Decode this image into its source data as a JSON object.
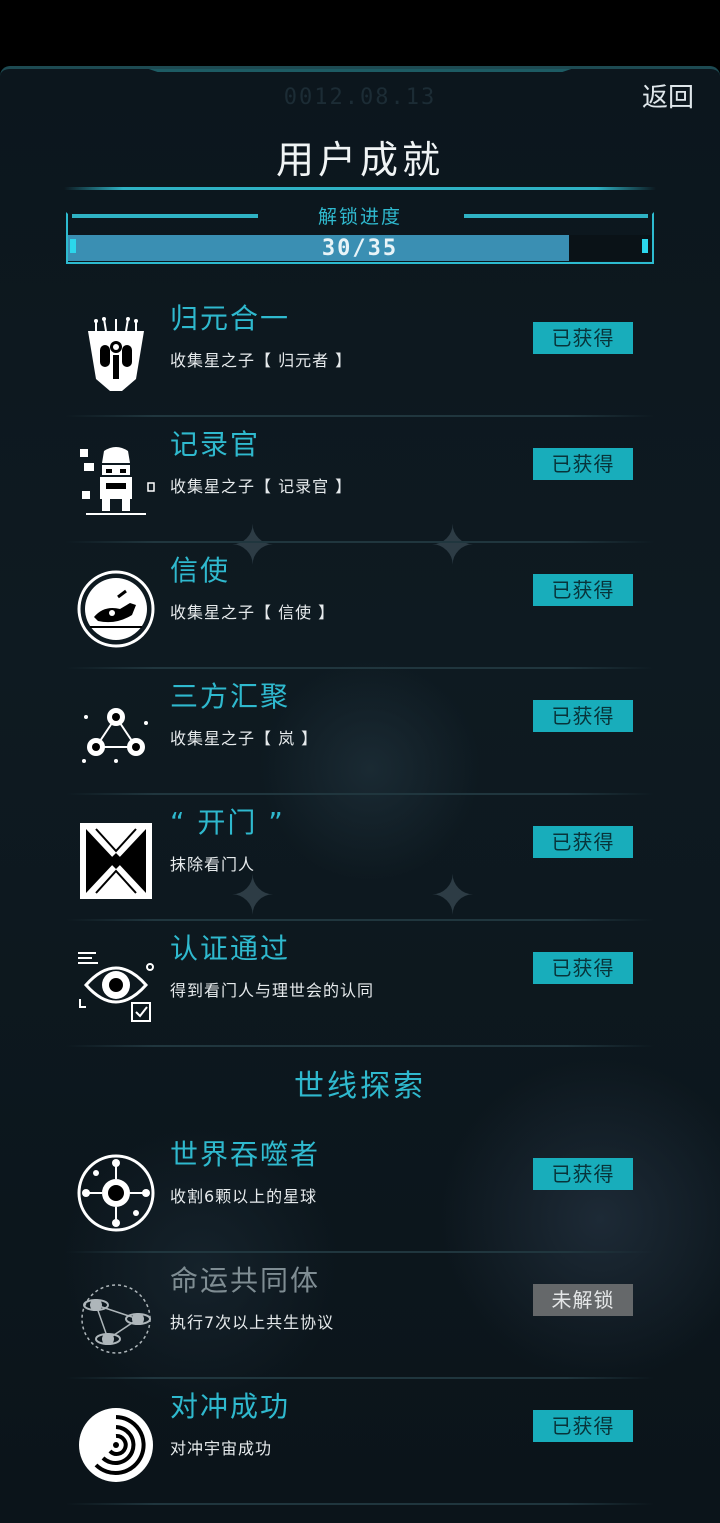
{
  "header": {
    "date": "0012.08.13",
    "back_label": "返回",
    "title": "用户成就"
  },
  "progress": {
    "label": "解锁进度",
    "text": "30/35",
    "current": 30,
    "total": 35
  },
  "achievements": [
    {
      "name": "归元合一",
      "desc": "收集星之子【 归元者 】",
      "status": "已获得",
      "icon": "robot-mask-icon",
      "unlocked": true
    },
    {
      "name": "记录官",
      "desc": "收集星之子【 记录官 】",
      "status": "已获得",
      "icon": "recorder-figure-icon",
      "unlocked": true
    },
    {
      "name": "信使",
      "desc": "收集星之子【 信使 】",
      "status": "已获得",
      "icon": "messenger-ship-icon",
      "unlocked": true
    },
    {
      "name": "三方汇聚",
      "desc": "收集星之子【 岚 】",
      "status": "已获得",
      "icon": "three-nodes-icon",
      "unlocked": true
    },
    {
      "name": "“ 开门 ”",
      "desc": "抹除看门人",
      "status": "已获得",
      "icon": "door-icon",
      "unlocked": true
    },
    {
      "name": "认证通过",
      "desc": "得到看门人与理世会的认同",
      "status": "已获得",
      "icon": "eye-check-icon",
      "unlocked": true
    }
  ],
  "section_title": "世线探索",
  "achievements2": [
    {
      "name": "世界吞噬者",
      "desc": "收割6颗以上的星球",
      "status": "已获得",
      "icon": "world-devourer-icon",
      "unlocked": true
    },
    {
      "name": "命运共同体",
      "desc": "执行7次以上共生协议",
      "status": "未解锁",
      "icon": "planets-orbit-icon",
      "unlocked": false
    },
    {
      "name": "对冲成功",
      "desc": "对冲宇宙成功",
      "status": "已获得",
      "icon": "spiral-icon",
      "unlocked": true
    }
  ],
  "colors": {
    "accent": "#2fb9ce",
    "badge_unlocked": "#18adbb",
    "badge_locked": "#65686a",
    "progress_fill": "#3a8fb3"
  }
}
